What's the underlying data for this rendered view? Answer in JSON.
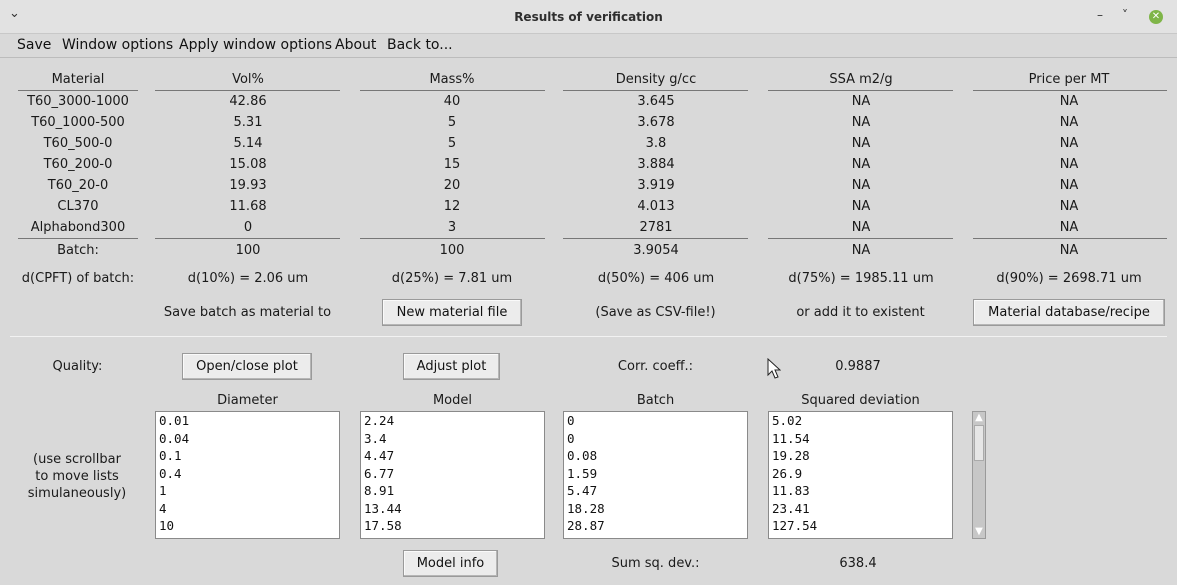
{
  "window": {
    "title": "Results of verification",
    "menu_icon": "chevron-down-icon",
    "minimize": "–",
    "maximize": "˅"
  },
  "menu": [
    "Save",
    "Window options",
    "Apply window options",
    "About",
    "Back to..."
  ],
  "table": {
    "headers": [
      "Material",
      "Vol%",
      "Mass%",
      "Density g/cc",
      "SSA m2/g",
      "Price per MT"
    ],
    "rows": [
      [
        "T60_3000-1000",
        "42.86",
        "40",
        "3.645",
        "NA",
        "NA"
      ],
      [
        "T60_1000-500",
        "5.31",
        "5",
        "3.678",
        "NA",
        "NA"
      ],
      [
        "T60_500-0",
        "5.14",
        "5",
        "3.8",
        "NA",
        "NA"
      ],
      [
        "T60_200-0",
        "15.08",
        "15",
        "3.884",
        "NA",
        "NA"
      ],
      [
        "T60_20-0",
        "19.93",
        "20",
        "3.919",
        "NA",
        "NA"
      ],
      [
        "CL370",
        "11.68",
        "12",
        "4.013",
        "NA",
        "NA"
      ],
      [
        "Alphabond300",
        "0",
        "3",
        "2781",
        "NA",
        "NA"
      ]
    ],
    "batch": [
      "Batch:",
      "100",
      "100",
      "3.9054",
      "NA",
      "NA"
    ],
    "dcpft": [
      "d(CPFT) of batch:",
      "d(10%) = 2.06 um",
      "d(25%) = 7.81 um",
      "d(50%) = 406 um",
      "d(75%) = 1985.11 um",
      "d(90%) = 2698.71 um"
    ]
  },
  "save_row": {
    "save_label": "Save batch as material to",
    "new_file_button": "New material file",
    "csv_note": "(Save as CSV-file!)",
    "add_note": "or add it to existent",
    "db_button": "Material database/recipe"
  },
  "quality": {
    "label": "Quality:",
    "open_plot_button": "Open/close plot",
    "adjust_plot_button": "Adjust plot",
    "corr_label": "Corr. coeff.:",
    "corr_value": "0.9887"
  },
  "lists": {
    "hint": [
      "(use scrollbar",
      "to move lists",
      "simulaneously)"
    ],
    "headers": [
      "Diameter",
      "Model",
      "Batch",
      "Squared deviation"
    ],
    "diameter": [
      "0.01",
      "0.04",
      "0.1",
      "0.4",
      "1",
      "4",
      "10"
    ],
    "model": [
      "2.24",
      "3.4",
      "4.47",
      "6.77",
      "8.91",
      "13.44",
      "17.58"
    ],
    "batch": [
      "0",
      "0",
      "0.08",
      "1.59",
      "5.47",
      "18.28",
      "28.87"
    ],
    "squared": [
      "5.02",
      "11.54",
      "19.28",
      "26.9",
      "11.83",
      "23.41",
      "127.54"
    ]
  },
  "footer": {
    "model_info_button": "Model info",
    "sum_label": "Sum sq. dev.:",
    "sum_value": "638.4"
  }
}
